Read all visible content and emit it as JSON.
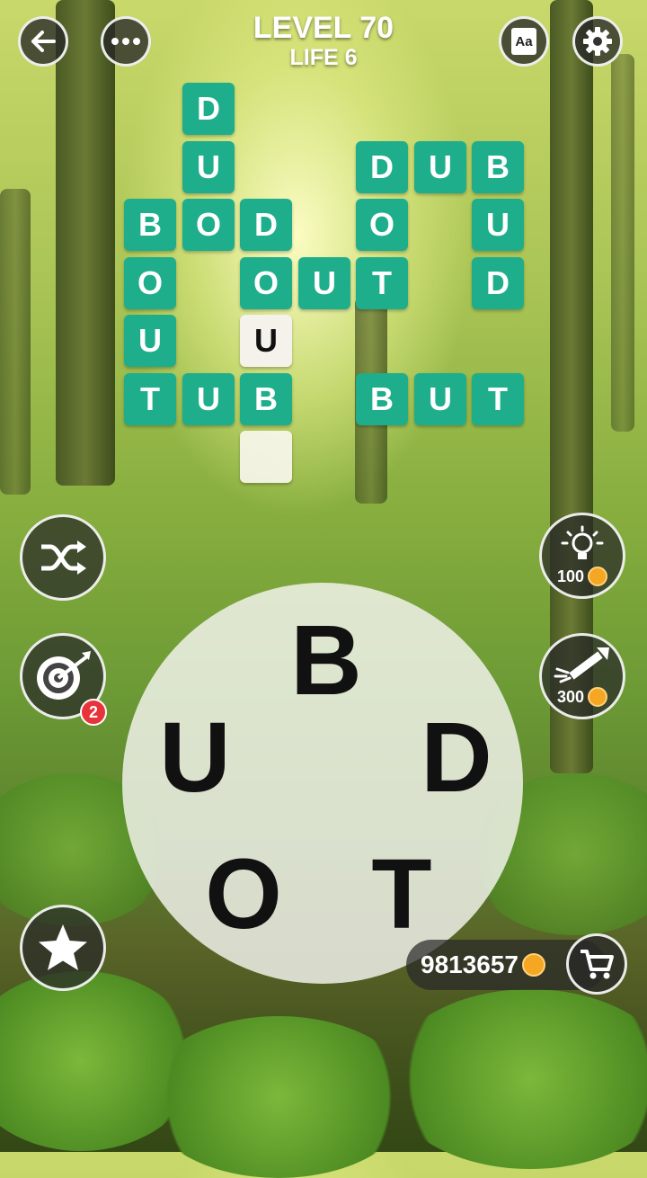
{
  "header": {
    "level": "LEVEL 70",
    "life": "LIFE 6"
  },
  "icons": {
    "back": "arrow-left-icon",
    "menu": "more-dots-icon",
    "dictionary": "dictionary-icon",
    "settings": "gear-icon",
    "shuffle": "shuffle-icon",
    "target": "target-icon",
    "hint": "lightbulb-icon",
    "rocket": "rocket-icon",
    "star": "star-icon",
    "cart": "cart-icon"
  },
  "dictionary_label": "Aa",
  "grid": {
    "tiles": [
      {
        "letter": "D",
        "state": "solved",
        "row": 0,
        "col": 1
      },
      {
        "letter": "U",
        "state": "solved",
        "row": 1,
        "col": 1
      },
      {
        "letter": "D",
        "state": "solved",
        "row": 1,
        "col": 4
      },
      {
        "letter": "U",
        "state": "solved",
        "row": 1,
        "col": 5
      },
      {
        "letter": "B",
        "state": "solved",
        "row": 1,
        "col": 6
      },
      {
        "letter": "B",
        "state": "solved",
        "row": 2,
        "col": 0
      },
      {
        "letter": "O",
        "state": "solved",
        "row": 2,
        "col": 1
      },
      {
        "letter": "D",
        "state": "solved",
        "row": 2,
        "col": 2
      },
      {
        "letter": "O",
        "state": "solved",
        "row": 2,
        "col": 4
      },
      {
        "letter": "U",
        "state": "solved",
        "row": 2,
        "col": 6
      },
      {
        "letter": "O",
        "state": "solved",
        "row": 3,
        "col": 0
      },
      {
        "letter": "O",
        "state": "solved",
        "row": 3,
        "col": 2
      },
      {
        "letter": "U",
        "state": "solved",
        "row": 3,
        "col": 3
      },
      {
        "letter": "T",
        "state": "solved",
        "row": 3,
        "col": 4
      },
      {
        "letter": "D",
        "state": "solved",
        "row": 3,
        "col": 6
      },
      {
        "letter": "U",
        "state": "solved",
        "row": 4,
        "col": 0
      },
      {
        "letter": "U",
        "state": "hint",
        "row": 4,
        "col": 2
      },
      {
        "letter": "T",
        "state": "solved",
        "row": 5,
        "col": 0
      },
      {
        "letter": "U",
        "state": "solved",
        "row": 5,
        "col": 1
      },
      {
        "letter": "B",
        "state": "solved",
        "row": 5,
        "col": 2
      },
      {
        "letter": "B",
        "state": "solved",
        "row": 5,
        "col": 4
      },
      {
        "letter": "U",
        "state": "solved",
        "row": 5,
        "col": 5
      },
      {
        "letter": "T",
        "state": "solved",
        "row": 5,
        "col": 6
      },
      {
        "letter": "",
        "state": "empty",
        "row": 6,
        "col": 2
      }
    ]
  },
  "wheel_letters": {
    "top": "B",
    "left": "U",
    "right": "D",
    "bottom_left": "O",
    "bottom_right": "T"
  },
  "hint_cost": "100",
  "rocket_cost": "300",
  "target_badge": "2",
  "coins": "9813657",
  "colors": {
    "tile": "#1fae8c",
    "hint_tile": "#f4f2ea",
    "badge": "#e8333a",
    "coin": "#f5a623"
  }
}
